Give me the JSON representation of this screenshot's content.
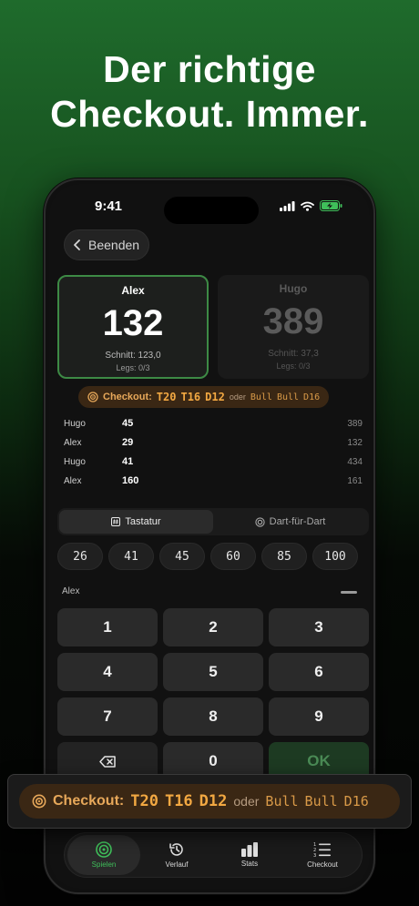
{
  "headline": {
    "line1": "Der richtige",
    "line2": "Checkout. Immer."
  },
  "status": {
    "time": "9:41"
  },
  "nav": {
    "back_label": "Beenden"
  },
  "players": [
    {
      "name": "Alex",
      "score": "132",
      "average": "Schnitt: 123,0",
      "legs": "Legs: 0/3",
      "active": true
    },
    {
      "name": "Hugo",
      "score": "389",
      "average": "Schnitt: 37,3",
      "legs": "Legs: 0/3",
      "active": false
    }
  ],
  "checkout": {
    "label": "Checkout:",
    "darts": [
      "T20",
      "T16",
      "D12"
    ],
    "or_label": "oder",
    "alt_darts": [
      "Bull",
      "Bull",
      "D16"
    ]
  },
  "history": [
    {
      "player": "Hugo",
      "scored": "45",
      "remaining": "389"
    },
    {
      "player": "Alex",
      "scored": "29",
      "remaining": "132"
    },
    {
      "player": "Hugo",
      "scored": "41",
      "remaining": "434"
    },
    {
      "player": "Alex",
      "scored": "160",
      "remaining": "161"
    }
  ],
  "input_mode": {
    "keyboard": "Tastatur",
    "dart_by_dart": "Dart-für-Dart",
    "selected": "keyboard"
  },
  "quick_scores": [
    "26",
    "41",
    "45",
    "60",
    "85",
    "100"
  ],
  "input": {
    "player_label": "Alex"
  },
  "keypad": {
    "keys": [
      "1",
      "2",
      "3",
      "4",
      "5",
      "6",
      "7",
      "8",
      "9"
    ],
    "zero": "0",
    "ok": "OK"
  },
  "tabs": [
    {
      "label": "Spielen",
      "icon": "target-icon",
      "active": true
    },
    {
      "label": "Verlauf",
      "icon": "history-icon",
      "active": false
    },
    {
      "label": "Stats",
      "icon": "bar-chart-icon",
      "active": false
    },
    {
      "label": "Checkout",
      "icon": "numbered-list-icon",
      "active": false
    }
  ],
  "colors": {
    "accent_green": "#3fbf5a",
    "checkout_orange": "#f2a842",
    "active_border": "#3d8a45"
  }
}
